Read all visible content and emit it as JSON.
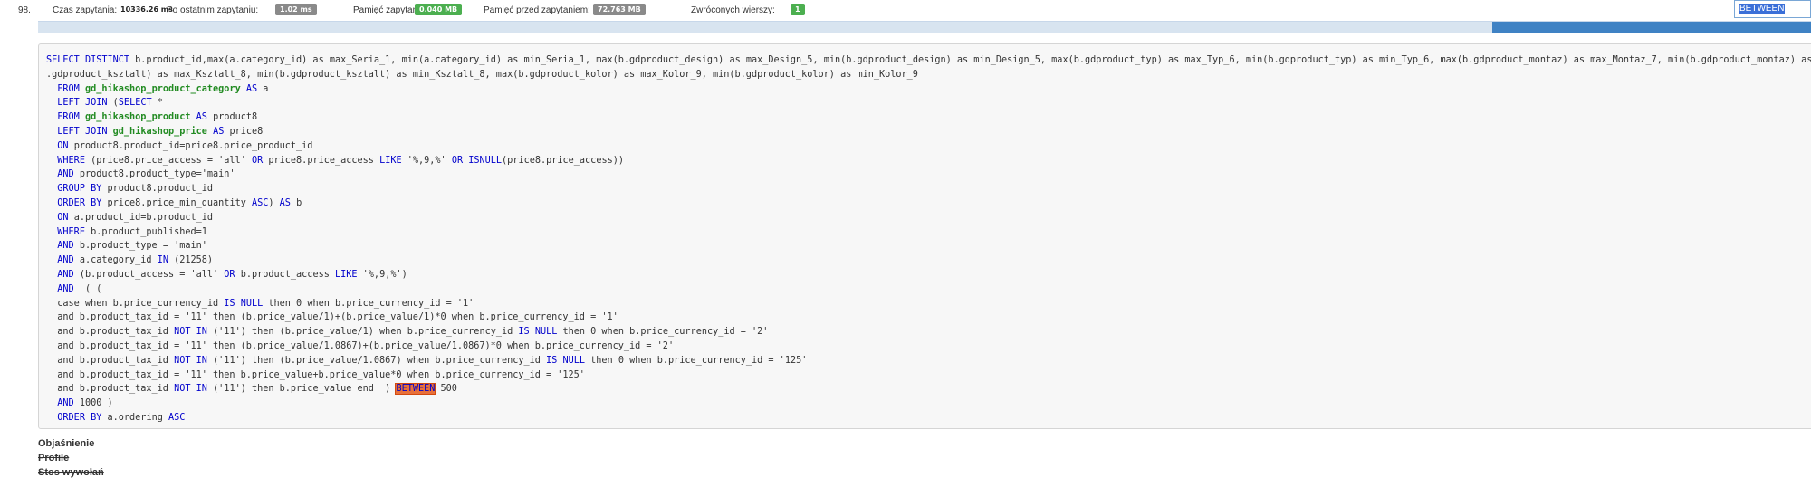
{
  "query": {
    "number": "98.",
    "stats": [
      {
        "label": "Czas zapytania:",
        "value": "10336.26 ms",
        "badge": "plain"
      },
      {
        "label": "Po ostatnim zapytaniu:",
        "value": "1.02 ms",
        "badge": "gray"
      },
      {
        "label": "Pamięć zapytania:",
        "value": "0.040 MB",
        "badge": "green"
      },
      {
        "label": "Pamięć przed zapytaniem:",
        "value": "72.763 MB",
        "badge": "gray"
      },
      {
        "label": "Zwróconych wierszy:",
        "value": "1",
        "badge": "green"
      }
    ],
    "progress_fraction": 0.18
  },
  "search": {
    "value": "BETWEEN"
  },
  "sql_lines": [
    "SELECT DISTINCT b.product_id,max(a.category_id) as max_Seria_1, min(a.category_id) as min_Seria_1, max(b.gdproduct_design) as max_Design_5, min(b.gdproduct_design) as min_Design_5, max(b.gdproduct_typ) as max_Typ_6, min(b.gdproduct_typ) as min_Typ_6, max(b.gdproduct_montaz) as max_Montaz_7, min(b.gdproduct_montaz) as min_Montaz_7, max(b",
    ".gdproduct_ksztalt) as max_Ksztalt_8, min(b.gdproduct_ksztalt) as min_Ksztalt_8, max(b.gdproduct_kolor) as max_Kolor_9, min(b.gdproduct_kolor) as min_Kolor_9",
    "  FROM gd_hikashop_product_category AS a",
    "  LEFT JOIN (SELECT *",
    "  FROM gd_hikashop_product AS product8",
    "  LEFT JOIN gd_hikashop_price AS price8",
    "  ON product8.product_id=price8.price_product_id",
    "  WHERE (price8.price_access = 'all' OR price8.price_access LIKE '%,9,%' OR ISNULL(price8.price_access))",
    "  AND product8.product_type='main'",
    "  GROUP BY product8.product_id",
    "  ORDER BY price8.price_min_quantity ASC) AS b",
    "  ON a.product_id=b.product_id",
    "  WHERE b.product_published=1",
    "  AND b.product_type = 'main'",
    "  AND a.category_id IN (21258)",
    "  AND (b.product_access = 'all' OR b.product_access LIKE '%,9,%')",
    "  AND  ( (",
    "  case when b.price_currency_id IS NULL then 0 when b.price_currency_id = '1'",
    "  and b.product_tax_id = '11' then (b.price_value/1)+(b.price_value/1)*0 when b.price_currency_id = '1'",
    "  and b.product_tax_id NOT IN ('11') then (b.price_value/1) when b.price_currency_id IS NULL then 0 when b.price_currency_id = '2'",
    "  and b.product_tax_id = '11' then (b.price_value/1.0867)+(b.price_value/1.0867)*0 when b.price_currency_id = '2'",
    "  and b.product_tax_id NOT IN ('11') then (b.price_value/1.0867) when b.price_currency_id IS NULL then 0 when b.price_currency_id = '125'",
    "  and b.product_tax_id = '11' then b.price_value+b.price_value*0 when b.price_currency_id = '125'",
    "  and b.product_tax_id NOT IN ('11') then b.price_value end  ) BETWEEN 500",
    "  AND 1000 )",
    "  ORDER BY a.ordering ASC"
  ],
  "links": {
    "explain": "Objaśnienie",
    "profile": "Profile",
    "call_stack": "Stos wywołań"
  }
}
